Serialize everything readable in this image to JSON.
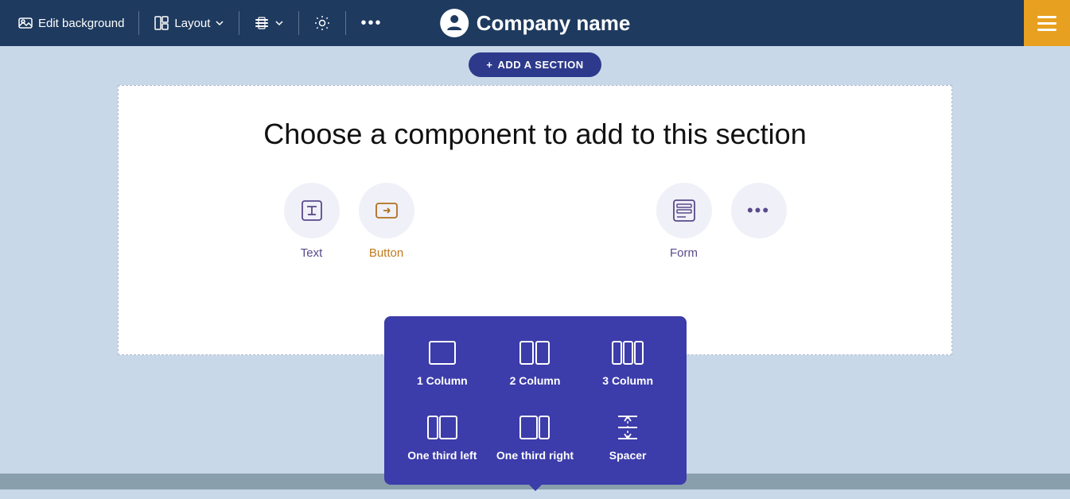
{
  "header": {
    "company_name": "Company name",
    "edit_background_label": "Edit background",
    "layout_label": "Layout",
    "add_section_label": "ADD A SECTION"
  },
  "toolbar": {
    "edit_background": "Edit background",
    "layout": "Layout",
    "settings_icon": "gear-icon",
    "more_icon": "more-icon"
  },
  "main": {
    "section_title": "Choose a component to add to this section",
    "components": [
      {
        "id": "text",
        "label": "Text",
        "icon": "text-icon"
      },
      {
        "id": "button",
        "label": "Button",
        "icon": "button-icon"
      },
      {
        "id": "more",
        "label": "",
        "icon": "more-icon"
      },
      {
        "id": "form",
        "label": "Form",
        "icon": "form-icon"
      }
    ]
  },
  "dropdown": {
    "items": [
      {
        "id": "1column",
        "label": "1 Column",
        "icon": "1col"
      },
      {
        "id": "2column",
        "label": "2 Column",
        "icon": "2col"
      },
      {
        "id": "3column",
        "label": "3 Column",
        "icon": "3col"
      },
      {
        "id": "onethirdleft",
        "label": "One third left",
        "icon": "1/3left"
      },
      {
        "id": "onethirdright",
        "label": "One third right",
        "icon": "1/3right"
      },
      {
        "id": "spacer",
        "label": "Spacer",
        "icon": "spacer"
      }
    ]
  },
  "add_section": "+ ADD A SECTION"
}
